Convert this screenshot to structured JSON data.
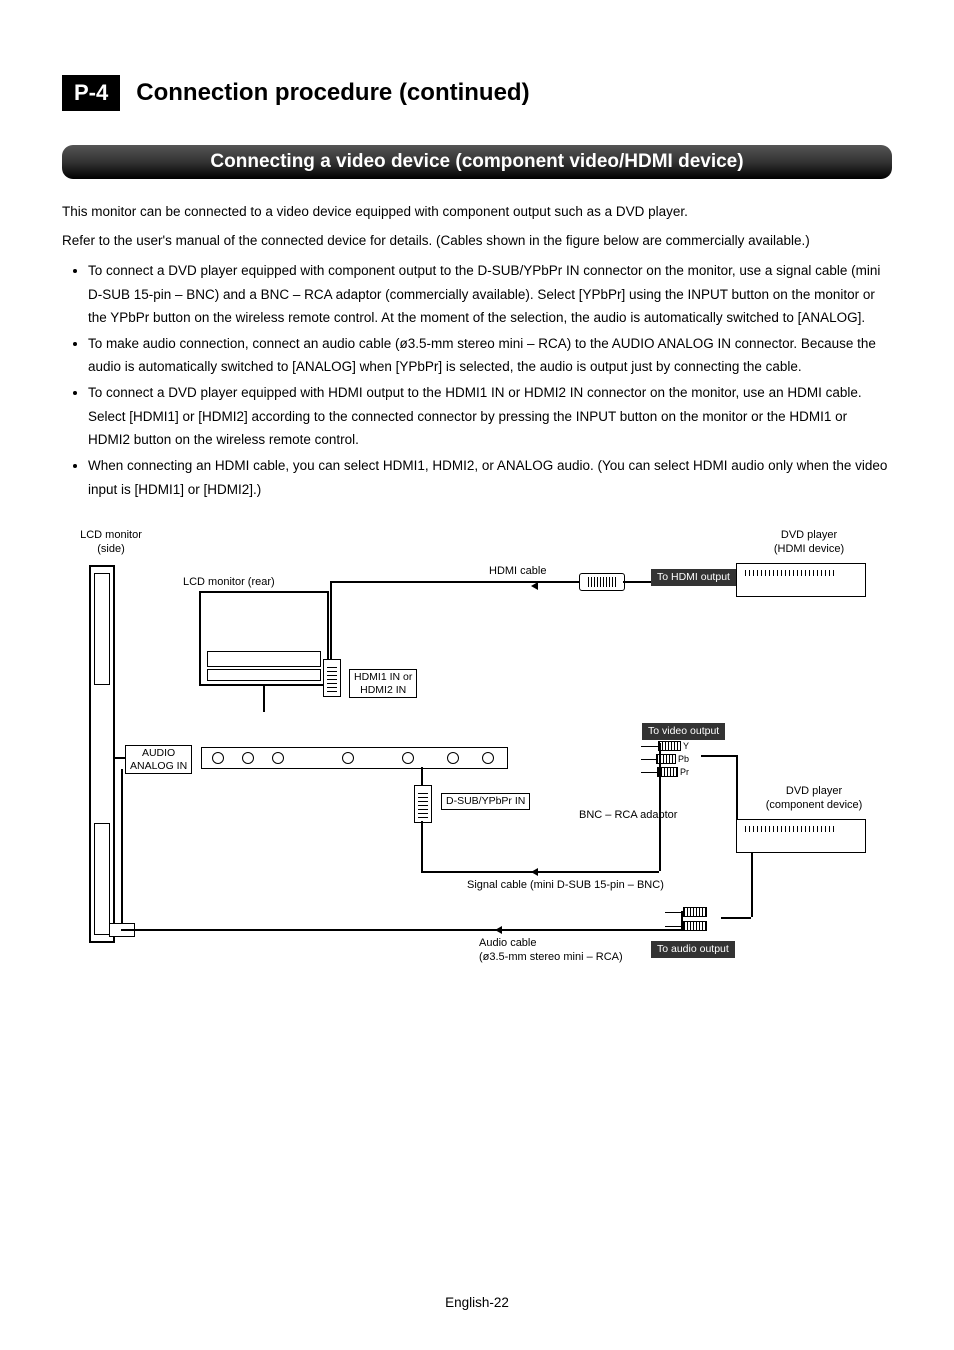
{
  "header": {
    "page_tag": "P-4",
    "title": "Connection procedure (continued)"
  },
  "banner": "Connecting a video device (component video/HDMI device)",
  "intro": [
    "This monitor can be connected to a video device equipped with component output such as a DVD player.",
    "Refer to the user's manual of the connected device for details. (Cables shown in the figure below are commercially available.)"
  ],
  "bullets": [
    "To connect a DVD player equipped with component output to the D-SUB/YPbPr IN connector on the monitor, use a signal cable (mini D-SUB 15-pin – BNC) and a BNC – RCA adaptor (commercially available). Select [YPbPr] using the INPUT button on the monitor or the YPbPr button on the wireless remote control. At the moment of the selection, the audio is automatically switched to [ANALOG].",
    "To make audio connection, connect an audio cable (ø3.5-mm stereo mini – RCA) to the AUDIO ANALOG IN connector. Because the audio is automatically switched to [ANALOG] when [YPbPr] is selected, the audio is output just by connecting the cable.",
    "To connect a DVD player equipped with HDMI output to the HDMI1 IN or HDMI2 IN connector on the monitor, use an HDMI cable. Select [HDMI1] or [HDMI2] according to the connected connector by pressing the INPUT button on the monitor or the HDMI1 or HDMI2 button on the wireless remote control.",
    "When connecting an HDMI cable, you can select HDMI1, HDMI2, or ANALOG audio. (You can select HDMI audio only when the video input is [HDMI1] or [HDMI2].)"
  ],
  "diagram": {
    "lcd_side": "LCD monitor\n(side)",
    "lcd_rear": "LCD monitor (rear)",
    "hdmi_cable": "HDMI cable",
    "to_hdmi_output": "To HDMI output",
    "dvd_hdmi": "DVD player\n(HDMI device)",
    "hdmi_in": "HDMI1 IN or\nHDMI2 IN",
    "audio_analog_in": "AUDIO\nANALOG IN",
    "to_video_output": "To video output",
    "y": "Y",
    "pb": "Pb",
    "pr": "Pr",
    "dsub_in": "D-SUB/YPbPr IN",
    "bnc_rca": "BNC – RCA adaptor",
    "dvd_component": "DVD player\n(component device)",
    "signal_cable": "Signal cable (mini D-SUB 15-pin – BNC)",
    "audio_cable": "Audio cable\n(ø3.5-mm stereo mini – RCA)",
    "to_audio_output": "To audio output"
  },
  "footer": "English-22"
}
